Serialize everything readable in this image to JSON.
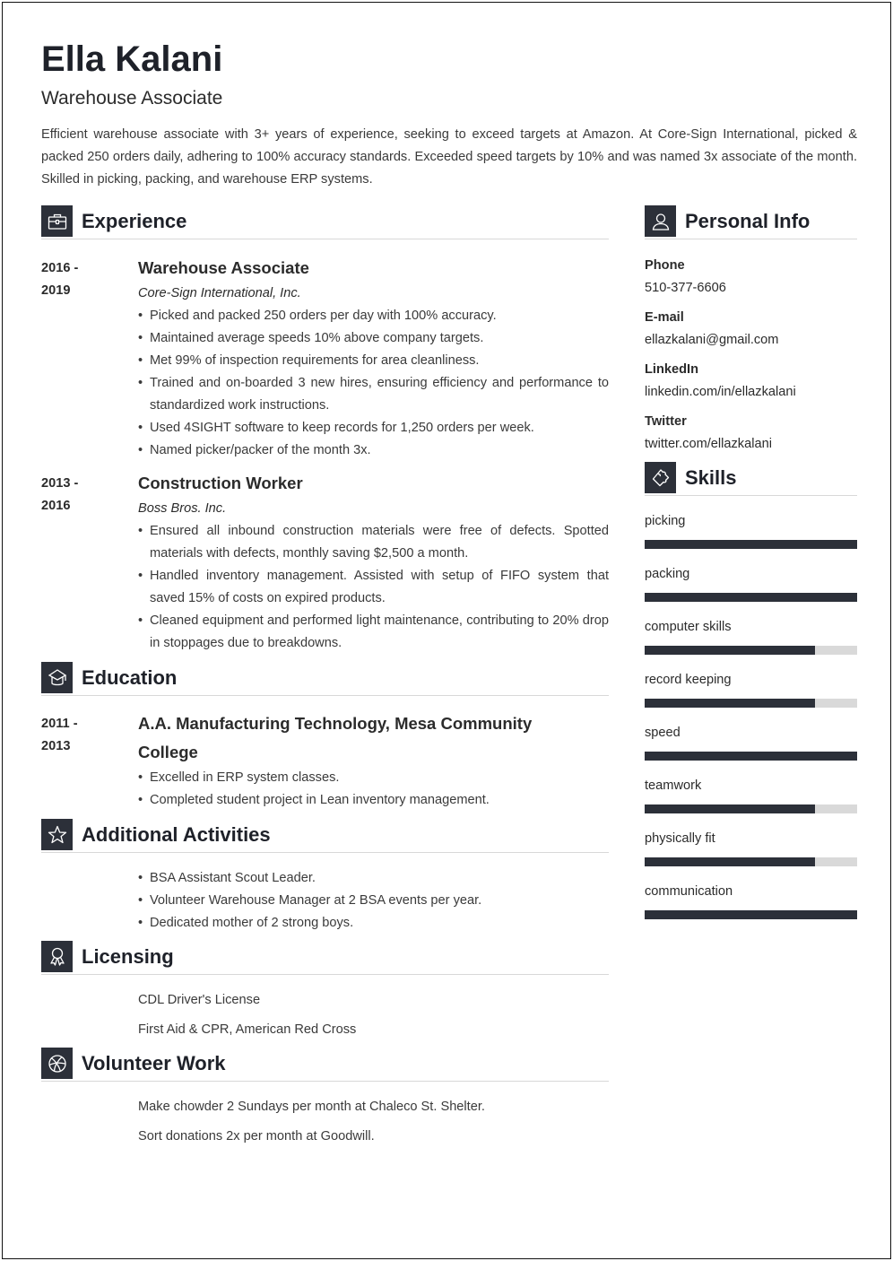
{
  "header": {
    "name": "Ella Kalani",
    "title": "Warehouse Associate",
    "summary": "Efficient warehouse associate with 3+ years of experience, seeking to exceed targets at Amazon. At Core-Sign International, picked & packed 250 orders daily, adhering to 100% accuracy standards. Exceeded speed targets by 10% and was named 3x associate of the month. Skilled in picking, packing, and warehouse ERP systems."
  },
  "experience": {
    "heading": "Experience",
    "icon": "briefcase-icon",
    "jobs": [
      {
        "date_start": "2016 -",
        "date_end": "2019",
        "role": "Warehouse Associate",
        "company": "Core-Sign International, Inc.",
        "bullets": [
          "Picked and packed 250 orders per day with 100% accuracy.",
          "Maintained average speeds 10% above company targets.",
          "Met 99% of inspection requirements for area cleanliness.",
          "Trained and on-boarded 3 new hires, ensuring efficiency and performance to standardized work instructions.",
          "Used 4SIGHT software to keep records for 1,250 orders per week.",
          "Named picker/packer of the month 3x."
        ]
      },
      {
        "date_start": "2013 -",
        "date_end": "2016",
        "role": "Construction Worker",
        "company": "Boss Bros. Inc.",
        "bullets": [
          "Ensured all inbound construction materials were free of defects. Spotted materials with defects, monthly saving $2,500 a month.",
          "Handled inventory management. Assisted with setup of FIFO system that saved 15% of costs on expired products.",
          "Cleaned equipment and performed light maintenance, contributing to 20% drop in stoppages due to breakdowns."
        ]
      }
    ]
  },
  "education": {
    "heading": "Education",
    "icon": "graduation-cap-icon",
    "entries": [
      {
        "date_start": "2011 -",
        "date_end": "2013",
        "degree": "A.A. Manufacturing Technology, Mesa Community College",
        "bullets": [
          "Excelled in ERP system classes.",
          "Completed student project in Lean inventory management."
        ]
      }
    ]
  },
  "activities": {
    "heading": "Additional Activities",
    "icon": "star-icon",
    "bullets": [
      "BSA Assistant Scout Leader.",
      "Volunteer Warehouse Manager at 2 BSA events per year.",
      "Dedicated mother of 2 strong boys."
    ]
  },
  "licensing": {
    "heading": "Licensing",
    "icon": "award-ribbon-icon",
    "items": [
      "CDL Driver's License",
      "First Aid & CPR, American Red Cross"
    ]
  },
  "volunteer": {
    "heading": "Volunteer Work",
    "icon": "globe-ball-icon",
    "items": [
      "Make chowder 2 Sundays per month at Chaleco St. Shelter.",
      "Sort donations 2x per month at Goodwill."
    ]
  },
  "personal_info": {
    "heading": "Personal Info",
    "icon": "user-icon",
    "fields": [
      {
        "label": "Phone",
        "value": "510-377-6606"
      },
      {
        "label": "E-mail",
        "value": "ellazkalani@gmail.com"
      },
      {
        "label": "LinkedIn",
        "value": "linkedin.com/in/ellazkalani"
      },
      {
        "label": "Twitter",
        "value": "twitter.com/ellazkalani"
      }
    ]
  },
  "skills": {
    "heading": "Skills",
    "icon": "puzzle-icon",
    "items": [
      {
        "name": "picking",
        "level": 1.0
      },
      {
        "name": "packing",
        "level": 1.0
      },
      {
        "name": "computer skills",
        "level": 0.8
      },
      {
        "name": "record keeping",
        "level": 0.8
      },
      {
        "name": "speed",
        "level": 1.0
      },
      {
        "name": "teamwork",
        "level": 0.8
      },
      {
        "name": "physically fit",
        "level": 0.8
      },
      {
        "name": "communication",
        "level": 1.0
      }
    ]
  },
  "colors": {
    "accent": "#2c3039",
    "track": "#d9d9d9",
    "divider": "#d8d8d8"
  }
}
